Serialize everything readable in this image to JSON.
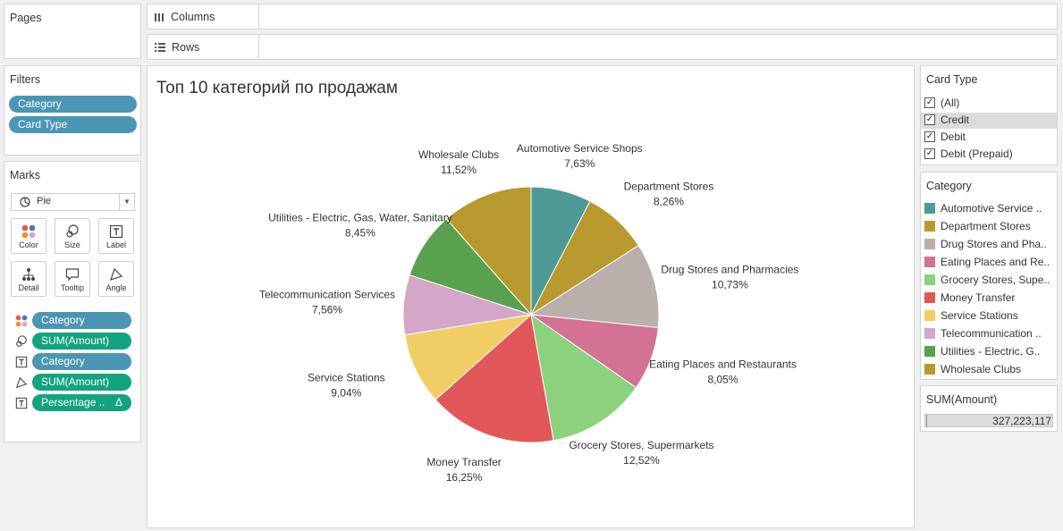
{
  "pages": {
    "title": "Pages"
  },
  "shelves": {
    "columns_label": "Columns",
    "rows_label": "Rows"
  },
  "filters": {
    "title": "Filters",
    "items": [
      "Category",
      "Card Type"
    ]
  },
  "marks": {
    "title": "Marks",
    "type_value": "Pie",
    "buttons": [
      {
        "label": "Color",
        "icon": "color-icon"
      },
      {
        "label": "Size",
        "icon": "size-icon"
      },
      {
        "label": "Label",
        "icon": "label-icon"
      },
      {
        "label": "Detail",
        "icon": "detail-icon"
      },
      {
        "label": "Tooltip",
        "icon": "tooltip-icon"
      },
      {
        "label": "Angle",
        "icon": "angle-icon"
      }
    ],
    "fields": [
      {
        "label": "Category",
        "color": "blue",
        "icon": "color-icon"
      },
      {
        "label": "SUM(Amount)",
        "color": "green",
        "icon": "size-icon"
      },
      {
        "label": "Category",
        "color": "blue",
        "icon": "label-icon"
      },
      {
        "label": "SUM(Amount)",
        "color": "green",
        "icon": "angle-icon"
      },
      {
        "label": "Persentage ..",
        "color": "green",
        "icon": "label-icon",
        "delta": "Δ"
      }
    ]
  },
  "card_type_filter": {
    "title": "Card Type",
    "options": [
      {
        "label": "(All)",
        "checked": true
      },
      {
        "label": "Credit",
        "checked": true,
        "highlighted": true
      },
      {
        "label": "Debit",
        "checked": true
      },
      {
        "label": "Debit (Prepaid)",
        "checked": true
      }
    ]
  },
  "category_legend": {
    "title": "Category",
    "items": [
      {
        "label": "Automotive Service ..",
        "color": "#4e9a97"
      },
      {
        "label": "Department Stores",
        "color": "#b8992d"
      },
      {
        "label": "Drug Stores and Pha..",
        "color": "#bab0ab"
      },
      {
        "label": "Eating Places and Re..",
        "color": "#d37295"
      },
      {
        "label": "Grocery Stores, Supe..",
        "color": "#8cd17d"
      },
      {
        "label": "Money Transfer",
        "color": "#e15759"
      },
      {
        "label": "Service Stations",
        "color": "#f1ce63"
      },
      {
        "label": "Telecommunication ..",
        "color": "#d4a6c8"
      },
      {
        "label": "Utilities - Electric, G..",
        "color": "#59a14f"
      },
      {
        "label": "Wholesale Clubs",
        "color": "#b8992d"
      }
    ]
  },
  "sum_amount": {
    "title": "SUM(Amount)",
    "value": "327,223,117"
  },
  "chart_data": {
    "type": "pie",
    "title": "Топ 10 категорий по продажам",
    "slices": [
      {
        "label": "Automotive Service Shops",
        "value": 7.63,
        "value_label": "7,63%",
        "color": "#4e9a97"
      },
      {
        "label": "Department Stores",
        "value": 8.26,
        "value_label": "8,26%",
        "color": "#b8992d"
      },
      {
        "label": "Drug Stores and Pharmacies",
        "value": 10.73,
        "value_label": "10,73%",
        "color": "#bab0ab"
      },
      {
        "label": "Eating Places and Restaurants",
        "value": 8.05,
        "value_label": "8,05%",
        "color": "#d37295"
      },
      {
        "label": "Grocery Stores, Supermarkets",
        "value": 12.52,
        "value_label": "12,52%",
        "color": "#8cd17d"
      },
      {
        "label": "Money Transfer",
        "value": 16.25,
        "value_label": "16,25%",
        "color": "#e15759"
      },
      {
        "label": "Service Stations",
        "value": 9.04,
        "value_label": "9,04%",
        "color": "#f1ce63"
      },
      {
        "label": "Telecommunication Services",
        "value": 7.56,
        "value_label": "7,56%",
        "color": "#d4a6c8"
      },
      {
        "label": "Utilities - Electric, Gas, Water, Sanitary",
        "value": 8.45,
        "value_label": "8,45%",
        "color": "#59a14f"
      },
      {
        "label": "Wholesale Clubs",
        "value": 11.52,
        "value_label": "11,52%",
        "color": "#b8992d"
      }
    ]
  }
}
